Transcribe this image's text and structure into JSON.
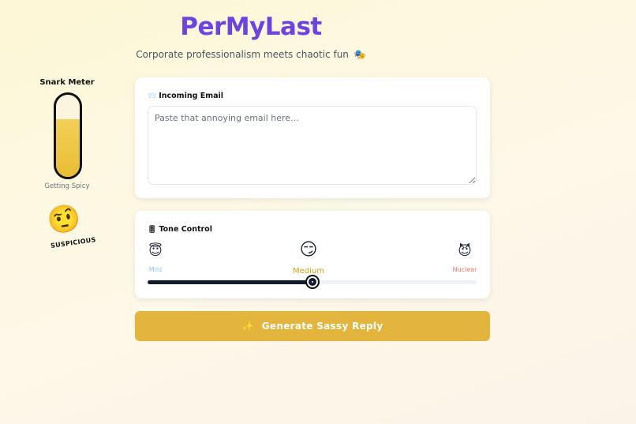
{
  "header": {
    "title": "PerMyLast",
    "tagline": "Corporate professionalism meets chaotic fun",
    "tagline_emoji": "🎭"
  },
  "snark_meter": {
    "title": "Snark Meter",
    "level": 0.7,
    "status": "Getting Spicy",
    "mood_emoji": "🤨",
    "mood_label": "SUSPICIOUS"
  },
  "email": {
    "icon": "📨",
    "label": "Incoming Email",
    "placeholder": "Paste that annoying email here...",
    "value": ""
  },
  "tone": {
    "icon": "🎚",
    "label": "Tone Control",
    "options": [
      {
        "emoji": "😇",
        "label": "Mild"
      },
      {
        "emoji": "😏",
        "label": "Medium"
      },
      {
        "emoji": "😈",
        "label": "Nuclear"
      }
    ],
    "value": 0.5
  },
  "generate": {
    "icon": "✨",
    "label": "Generate Sassy Reply"
  },
  "colors": {
    "accent": "#6d44dd",
    "button": "#e3b53d",
    "meter_fill": "#e9bd35"
  }
}
